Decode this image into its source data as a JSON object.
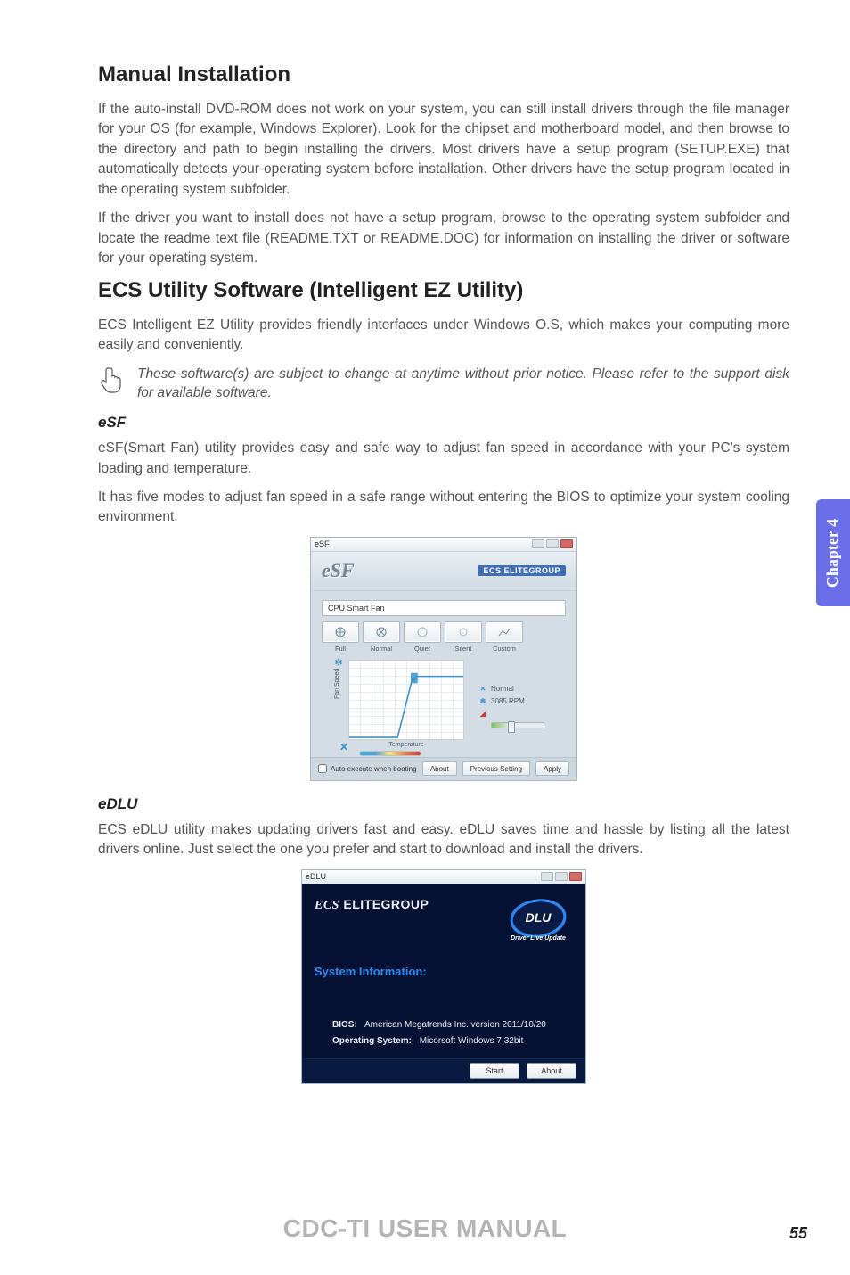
{
  "section1": {
    "title": "Manual Installation",
    "p1": "If the auto-install DVD-ROM does not work on your system, you can still install drivers through the file manager for your OS (for example, Windows Explorer). Look for the chipset and motherboard model, and then browse to the directory and path to begin installing the drivers. Most drivers have a setup program (SETUP.EXE) that automatically detects your operating system before installation. Other drivers have the setup program located in the operating system subfolder.",
    "p2": "If the driver you want to install does not have a setup program, browse to the operating system subfolder and locate the readme text file (README.TXT or README.DOC) for information on installing the driver or software for your operating system."
  },
  "section2": {
    "title": "ECS Utility Software (Intelligent EZ Utility)",
    "p1": "ECS Intelligent EZ Utility provides friendly interfaces under Windows O.S, which makes your computing more easily and conveniently.",
    "note": "These software(s) are subject to change at anytime without prior notice. Please refer to the support disk for available software."
  },
  "esf_section": {
    "title": "eSF",
    "p1": "eSF(Smart Fan) utility provides easy and safe way to adjust fan speed in accordance with your PC's system loading and temperature.",
    "p2": "It has five modes to adjust fan speed in a safe range without entering the BIOS to optimize your system cooling environment."
  },
  "esf_win": {
    "title": "eSF",
    "logo": "eSF",
    "brand": "ECS ELITEGROUP",
    "selector": "CPU Smart Fan",
    "modes": [
      "Full",
      "Normal",
      "Quiet",
      "Silent",
      "Custom"
    ],
    "ylabel": "Fan Speed",
    "xlabel": "Temperature",
    "legend_normal": "Normal",
    "legend_rpm": "3085 RPM",
    "checkbox": "Auto execute when booting",
    "btn_about": "About",
    "btn_prev": "Previous Setting",
    "btn_apply": "Apply"
  },
  "edlu_section": {
    "title": "eDLU",
    "p1": "ECS eDLU utility makes updating drivers fast and easy. eDLU saves time and hassle by listing all the latest drivers online. Just select the one you prefer and start to download and install the drivers."
  },
  "edlu_win": {
    "title": "eDLU",
    "brand": "ECS ELITEGROUP",
    "badge_top": "DLU",
    "badge_sub": "Driver Live Update",
    "section_title": "System Information:",
    "bios_k": "BIOS:",
    "bios_v": "American Megatrends Inc. version 2011/10/20",
    "os_k": "Operating System:",
    "os_v": "Micorsoft Windows 7 32bit",
    "btn_start": "Start",
    "btn_about": "About"
  },
  "chapter_tab": "Chapter 4",
  "footer_title": "CDC-TI USER MANUAL",
  "page_number": "55"
}
